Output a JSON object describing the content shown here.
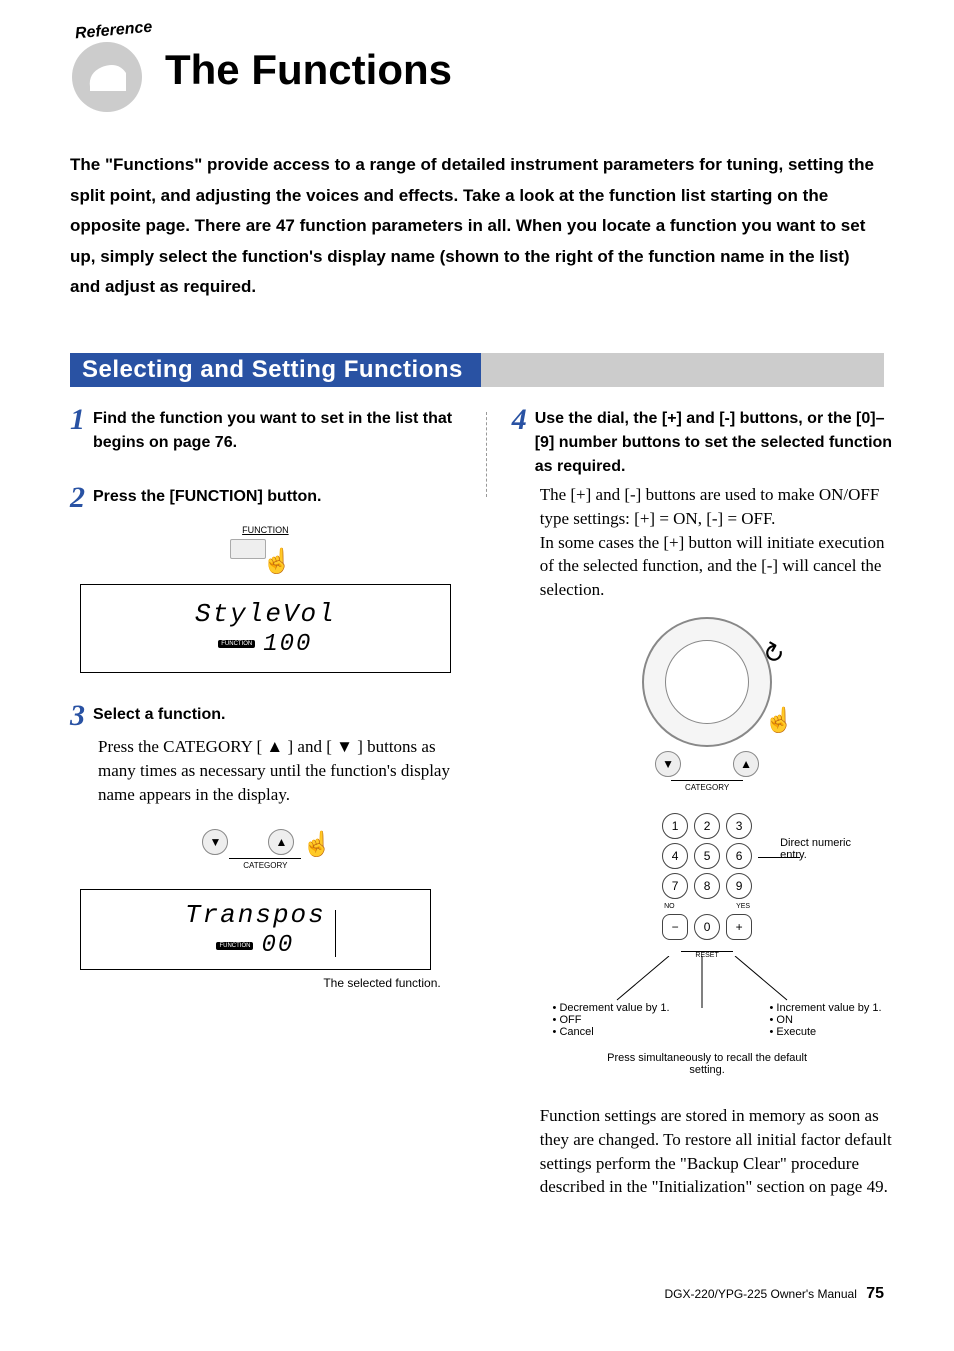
{
  "header": {
    "badge_label": "Reference",
    "title": "The Functions"
  },
  "intro": "The \"Functions\" provide access to a range of detailed instrument parameters for tuning, setting the split point, and adjusting the voices and effects. Take a look at the function list starting on the opposite page. There are 47 function parameters in all. When you locate a function you want to set up, simply select the function's display name (shown to the right of the function name in the list) and adjust as required.",
  "section_title": "Selecting and Setting Functions",
  "steps": {
    "s1": {
      "num": "1",
      "title": "Find the function you want to set in the list that begins on page 76."
    },
    "s2": {
      "num": "2",
      "title": "Press the [FUNCTION] button.",
      "btn_label": "FUNCTION",
      "display_main": "StyleVol",
      "display_tag": "FUNCTION",
      "display_sub": "100"
    },
    "s3": {
      "num": "3",
      "title": "Select a function.",
      "body": "Press the CATEGORY [ ▲ ] and [ ▼ ] buttons as many times as necessary until the function's display name appears in the display.",
      "cat_label": "CATEGORY",
      "display_main": "Transpos",
      "display_tag": "FUNCTION",
      "display_sub": "00",
      "caption": "The selected function."
    },
    "s4": {
      "num": "4",
      "title": "Use the dial, the [+] and [-] buttons, or the [0]–[9] number buttons to set the selected function as required.",
      "body1": "The [+] and [-] buttons are used to make ON/OFF type settings: [+] = ON, [-] = OFF.",
      "body2": "In some cases the [+] button will initiate execution of the selected function, and the [-] will cancel the selection.",
      "cat_label": "CATEGORY",
      "keypad": {
        "k1": "1",
        "k2": "2",
        "k3": "3",
        "k4": "4",
        "k5": "5",
        "k6": "6",
        "k7": "7",
        "k8": "8",
        "k9": "9",
        "k0": "0",
        "kminus": "−",
        "kplus": "+",
        "no": "NO",
        "yes": "YES",
        "reset": "RESET"
      },
      "annot_numeric": "Direct numeric entry.",
      "annot_left_1": "• Decrement value by 1.",
      "annot_left_2": "• OFF",
      "annot_left_3": "• Cancel",
      "annot_right_1": "• Increment value by 1.",
      "annot_right_2": "• ON",
      "annot_right_3": "• Execute",
      "annot_bottom": "Press simultaneously to recall the default setting.",
      "para": "Function settings are stored in memory as soon as they are changed. To restore all initial factor default settings perform the \"Backup Clear\" procedure described in the \"Initialization\" section on page 49."
    }
  },
  "footer": {
    "manual": "DGX-220/YPG-225  Owner's Manual",
    "page": "75"
  }
}
